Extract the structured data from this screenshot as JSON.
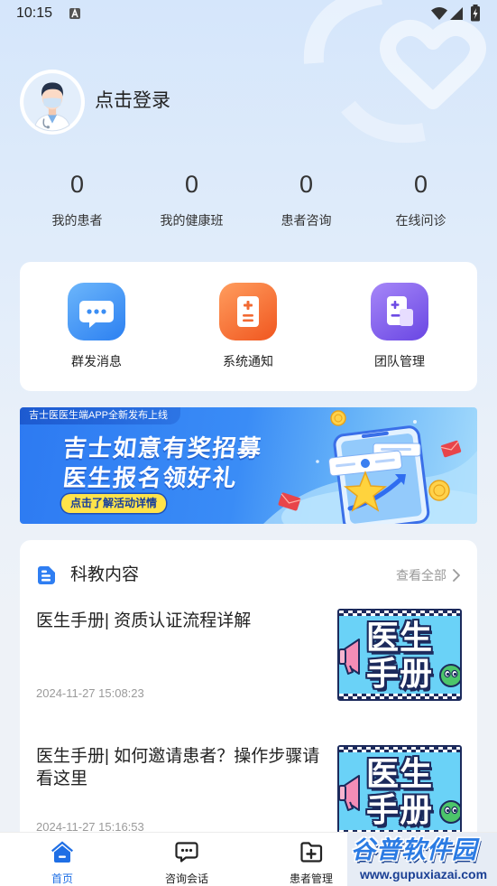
{
  "status_bar": {
    "time": "10:15",
    "icons": [
      "a-notification-icon",
      "wifi-icon",
      "signal-icon",
      "battery-charging-icon"
    ]
  },
  "profile": {
    "avatar_icon": "doctor-avatar",
    "login_text": "点击登录"
  },
  "stats": [
    {
      "value": "0",
      "label": "我的患者"
    },
    {
      "value": "0",
      "label": "我的健康班"
    },
    {
      "value": "0",
      "label": "患者咨询"
    },
    {
      "value": "0",
      "label": "在线问诊"
    }
  ],
  "quick_actions": [
    {
      "label": "群发消息",
      "icon": "chat-bubble-icon",
      "color": "#2f86f2"
    },
    {
      "label": "系统通知",
      "icon": "notice-document-icon",
      "color": "#f5652e"
    },
    {
      "label": "团队管理",
      "icon": "team-document-icon",
      "color": "#7b57ec"
    }
  ],
  "banner": {
    "tag": "吉士医医生端APP全新发布上线",
    "headline_1": "吉士如意有奖招募",
    "headline_2": "医生报名领好礼",
    "cta": "点击了解活动详情"
  },
  "science": {
    "title": "科教内容",
    "view_all": "查看全部",
    "articles": [
      {
        "title": "医生手册| 资质认证流程详解",
        "date": "2024-11-27 15:08:23",
        "thumb_line_1": "医生",
        "thumb_line_2": "手册"
      },
      {
        "title": "医生手册| 如何邀请患者？操作步骤请看这里",
        "date": "2024-11-27 15:16:53",
        "thumb_line_1": "医生",
        "thumb_line_2": "手册"
      }
    ]
  },
  "tab_bar": {
    "tabs": [
      {
        "label": "首页",
        "icon": "home-icon",
        "active": true
      },
      {
        "label": "咨询会话",
        "icon": "chat-icon",
        "active": false
      },
      {
        "label": "患者管理",
        "icon": "folder-plus-icon",
        "active": false
      }
    ]
  },
  "watermark": {
    "name": "谷普软件园",
    "url": "www.gupuxiazai.com"
  },
  "colors": {
    "accent": "#1f6fe5",
    "background": "#e0ecfa",
    "text": "#222222",
    "muted": "#999999",
    "cta_yellow": "#ffe34a"
  }
}
